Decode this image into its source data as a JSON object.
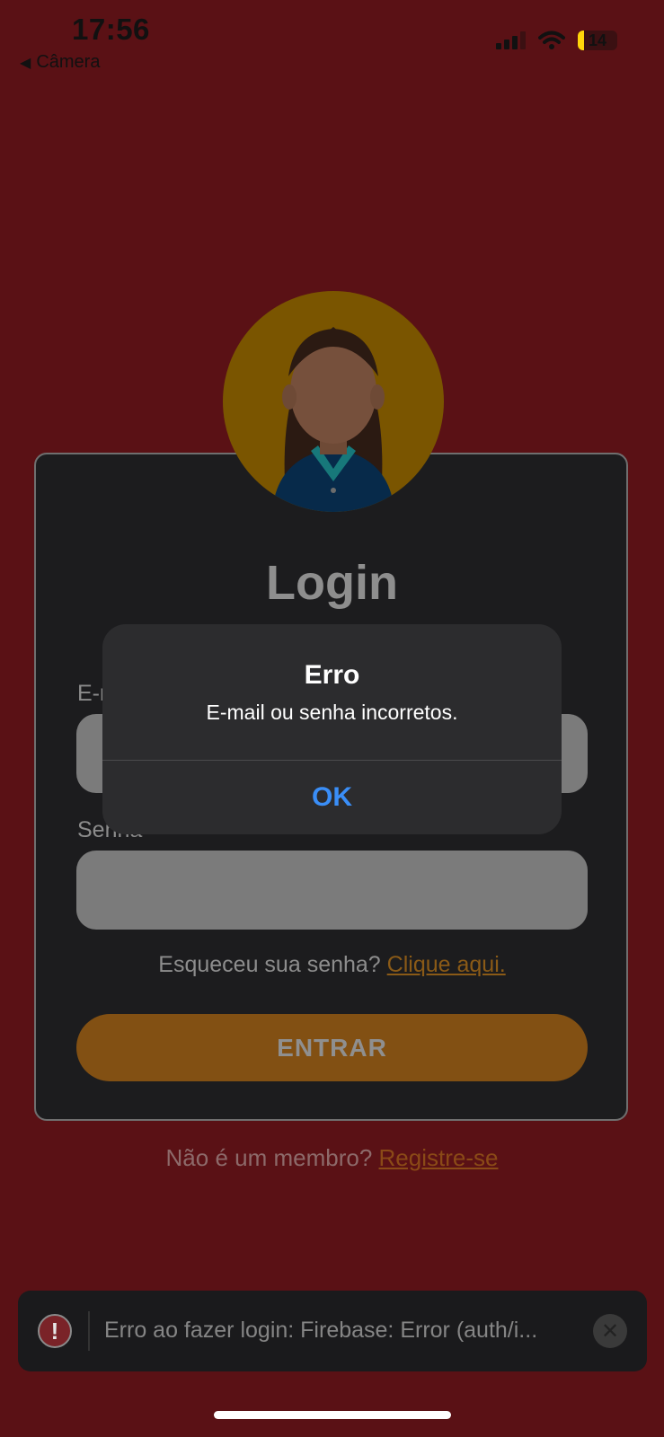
{
  "status_bar": {
    "time": "17:56",
    "back_label": "Câmera",
    "battery_level": "14",
    "battery_accent_color": "#ffd60a"
  },
  "login_card": {
    "title": "Login",
    "email_label": "E-mail",
    "password_label": "Senha",
    "email_value": "",
    "password_value": "",
    "forgot_text": "Esqueceu sua senha?",
    "forgot_link": "Clique aqui.",
    "submit_label": "ENTRAR",
    "avatar_icon": "woman-avatar-icon"
  },
  "register": {
    "text": "Não é um membro?",
    "link": "Registre-se"
  },
  "alert": {
    "title": "Erro",
    "message": "E-mail ou senha incorretos.",
    "ok_label": "OK"
  },
  "toast": {
    "message": "Erro ao fazer login: Firebase: Error (auth/i...",
    "icon": "error-icon"
  },
  "colors": {
    "background": "#5a1115",
    "card": "#1c1c1e",
    "accent_gold": "#825013",
    "link_blue": "#3a8ef7"
  }
}
